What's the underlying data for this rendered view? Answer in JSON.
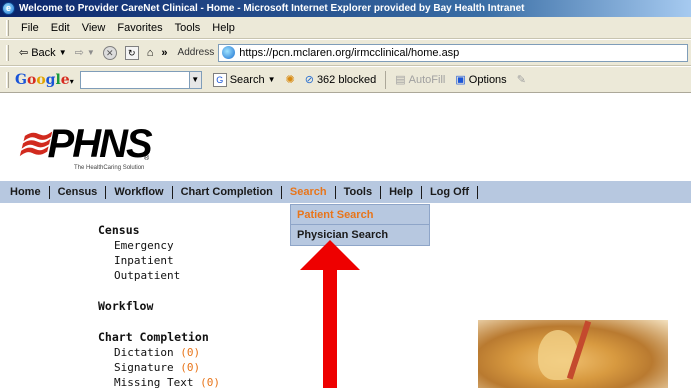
{
  "window": {
    "title": "Welcome to Provider CareNet Clinical - Home - Microsoft Internet Explorer provided by Bay Health Intranet"
  },
  "menu": [
    "File",
    "Edit",
    "View",
    "Favorites",
    "Tools",
    "Help"
  ],
  "navigation": {
    "back_label": "Back",
    "address_label": "Address",
    "url": "https://pcn.mclaren.org/irmcclinical/home.asp"
  },
  "google_toolbar": {
    "logo": "Google",
    "search_label": "Search",
    "blocked_label": "362 blocked",
    "autofill_label": "AutoFill",
    "options_label": "Options"
  },
  "site": {
    "logo_text": "PHNS",
    "tagline": "The HealthCaring Solution",
    "registered_mark": "®",
    "nav": [
      "Home",
      "Census",
      "Workflow",
      "Chart Completion",
      "Search",
      "Tools",
      "Help",
      "Log Off"
    ],
    "active_nav": "Search",
    "search_dropdown": [
      "Patient Search",
      "Physician Search"
    ],
    "sidebar": {
      "census": {
        "label": "Census",
        "items": [
          "Emergency",
          "Inpatient",
          "Outpatient"
        ]
      },
      "workflow": {
        "label": "Workflow"
      },
      "chart_completion": {
        "label": "Chart Completion",
        "items": [
          {
            "label": "Dictation",
            "count": "(0)"
          },
          {
            "label": "Signature",
            "count": "(0)"
          },
          {
            "label": "Missing Text",
            "count": "(0)"
          }
        ]
      }
    }
  },
  "colors": {
    "accent": "#e8751a",
    "nav_bg": "#b7c8e0",
    "arrow": "#ee0000"
  }
}
